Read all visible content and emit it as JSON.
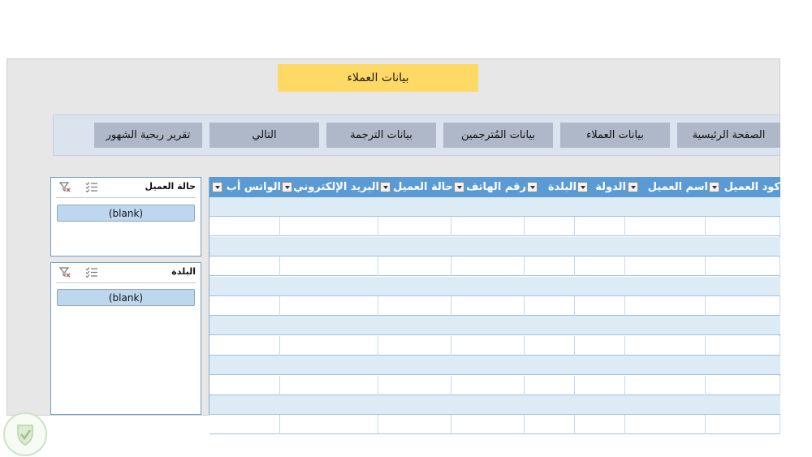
{
  "header": {
    "title": "بيانات العملاء"
  },
  "nav": {
    "buttons": [
      {
        "label": "الصفحة الرئيسية"
      },
      {
        "label": "بيانات العملاء"
      },
      {
        "label": "بيانات المُترجمين"
      },
      {
        "label": "بيانات الترجمة"
      },
      {
        "label": "التالي"
      },
      {
        "label": "تقرير ربحية الشهور"
      }
    ]
  },
  "slicers": [
    {
      "title": "حالة العميل",
      "items": [
        "(blank)"
      ]
    },
    {
      "title": "البلدة",
      "items": [
        "(blank)"
      ]
    }
  ],
  "table": {
    "columns": [
      "كود العميل",
      "اسم العميل",
      "الدولة",
      "البلدة",
      "رقم الهاتف",
      "حالة العميل",
      "البريد الإلكتروني",
      "الواتس أب"
    ],
    "row_count": 12
  },
  "colors": {
    "title_bg": "#ffd966",
    "nav_button_bg": "#aeb8c8",
    "header_bg": "#5b9bd5",
    "band_bg": "#ddebf7"
  }
}
